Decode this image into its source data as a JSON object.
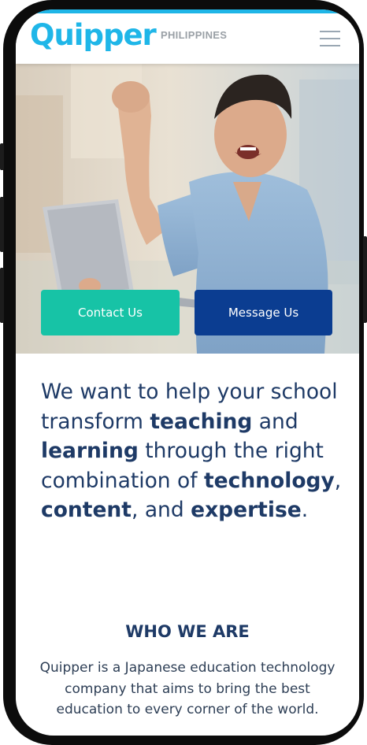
{
  "header": {
    "logo_text": "Quipper",
    "country_label": "PHILIPPINES",
    "menu_icon": "hamburger-menu-icon",
    "accent_color": "#1fb6e8"
  },
  "hero": {
    "image_subject": "excited man with raised fist holding laptop",
    "contact_button": "Contact Us",
    "message_button": "Message Us",
    "contact_color": "#17c3a6",
    "message_color": "#0b3d91"
  },
  "intro": {
    "part1": "We want to help your school transform ",
    "bold1": "teaching",
    "part2": " and ",
    "bold2": "learning",
    "part3": " through the right combination of ",
    "bold3": "technology",
    "part4": ", ",
    "bold4": "content",
    "part5": ", and ",
    "bold5": "expertise",
    "part6": "."
  },
  "who_we_are": {
    "title": "WHO WE ARE",
    "body": "Quipper is a Japanese education technology company that aims to bring the best education to every corner of the world."
  }
}
